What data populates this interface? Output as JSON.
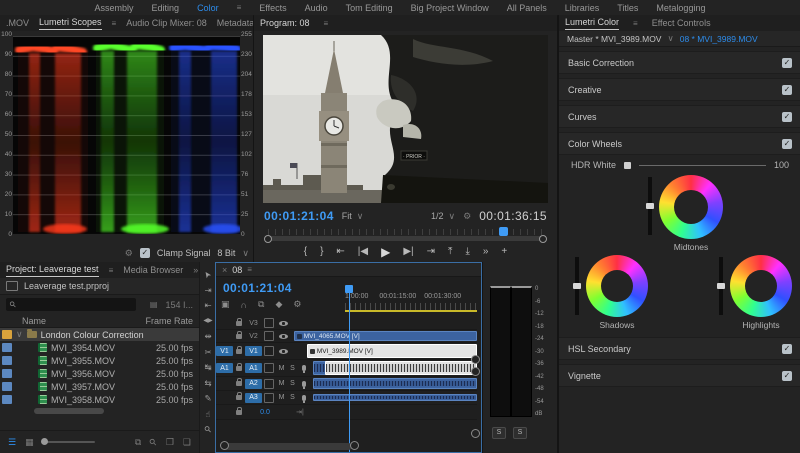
{
  "colors": {
    "accent": "#2d8ceb",
    "timecode_blue": "#3f9bf5",
    "selected_clip": "#e4e4e4",
    "clip_blue": "#3c63a0",
    "work_bar_yellow": "#c9b929",
    "track_chip_blue": "#2d6da8",
    "folder_label": "#d9a33c",
    "clip_label": "#5c88c0"
  },
  "workspace": {
    "tabs": [
      "Assembly",
      "Editing",
      "Color",
      "Effects",
      "Audio",
      "Tom Editing",
      "Big Project Window",
      "All Panels",
      "Libraries",
      "Titles",
      "Metalogging"
    ],
    "active_tab": "Color",
    "menu_glyph": "≡"
  },
  "scopes": {
    "hidden_tab": ".MOV",
    "tab_active": "Lumetri Scopes",
    "tab2": "Audio Clip Mixer: 08",
    "tab3": "Metadata",
    "overflow": "»",
    "left_axis": [
      "100",
      "90",
      "80",
      "70",
      "60",
      "50",
      "40",
      "30",
      "20",
      "10",
      "0"
    ],
    "right_axis": [
      "255",
      "230",
      "204",
      "178",
      "153",
      "127",
      "102",
      "76",
      "51",
      "25",
      "0"
    ],
    "footer": {
      "wrench": "⚙",
      "clamp_label": "Clamp Signal",
      "bit_depth": "8 Bit",
      "caret": "∨",
      "check": "✓"
    }
  },
  "chart_data": {
    "type": "rgb-parade-waveform",
    "title": "Lumetri Scopes — RGB Parade",
    "ylabel_left_percent": [
      100,
      90,
      80,
      70,
      60,
      50,
      40,
      30,
      20,
      10,
      0
    ],
    "ylabel_right_8bit": [
      255,
      230,
      204,
      178,
      153,
      127,
      102,
      76,
      51,
      25,
      0
    ],
    "channels": [
      "red",
      "green",
      "blue"
    ],
    "highlight_level_percent": 93,
    "shadow_level_percent": 2,
    "grid": true
  },
  "program": {
    "tab": "Program: 08",
    "menu_glyph": "≡",
    "timecode": "00:01:21:04",
    "zoom_level": "Fit",
    "playback_resolution": "1/2",
    "duration": "00:01:36:15",
    "caret": "∨",
    "wrench": "⚙",
    "playhead_pos_pct": 84,
    "plaque_text": "· PRIOR ·",
    "transport": {
      "mark_in": "{",
      "mark_out": "}",
      "go_to_in": "⇤",
      "step_back": "|◀",
      "play": "▶",
      "step_fwd": "▶|",
      "go_to_out": "⇥",
      "lift": "⤒",
      "extract": "⤓",
      "more": "»",
      "add": "+"
    }
  },
  "lumetri": {
    "tab_active": "Lumetri Color",
    "tab2": "Effect Controls",
    "menu_glyph": "≡",
    "master_label": "Master * MVI_3989.MOV",
    "clip_label": "08 * MVI_3989.MOV",
    "caret": "∨",
    "sections": [
      "Basic Correction",
      "Creative",
      "Curves",
      "Color Wheels",
      "HSL Secondary",
      "Vignette"
    ],
    "check": "✓",
    "hdr_white": {
      "label": "HDR White",
      "max": "100"
    },
    "wheels": [
      "Shadows",
      "Midtones",
      "Highlights"
    ]
  },
  "project": {
    "tab_active": "Project: Leaverage test",
    "tab2": "Media Browser",
    "overflow": "»",
    "file_name": "Leaverage test.prproj",
    "search_glyph": "⚲",
    "items_count": "154 I...",
    "columns": {
      "name": "Name",
      "frame_rate": "Frame Rate"
    },
    "folder": {
      "chevron": "∨",
      "name": "London Colour Correction"
    },
    "clips": [
      {
        "name": "MVI_3954.MOV",
        "fps": "25.00 fps"
      },
      {
        "name": "MVI_3955.MOV",
        "fps": "25.00 fps"
      },
      {
        "name": "MVI_3956.MOV",
        "fps": "25.00 fps"
      },
      {
        "name": "MVI_3957.MOV",
        "fps": "25.00 fps"
      },
      {
        "name": "MVI_3958.MOV",
        "fps": "25.00 fps"
      }
    ],
    "footer": {
      "list_view": "☰",
      "icon_view": "▦",
      "automate": "⧉",
      "find": "⚲",
      "new_bin": "❒",
      "new_item": "❏"
    }
  },
  "tools": {
    "items": [
      {
        "name": "selection",
        "glyph": "➤"
      },
      {
        "name": "track-select-forward",
        "glyph": "⇥"
      },
      {
        "name": "ripple-edit",
        "glyph": "⇤"
      },
      {
        "name": "rolling-edit",
        "glyph": "◀▶"
      },
      {
        "name": "rate-stretch",
        "glyph": "⇹"
      },
      {
        "name": "razor",
        "glyph": "✂"
      },
      {
        "name": "slip",
        "glyph": "↹"
      },
      {
        "name": "slide",
        "glyph": "⇆"
      },
      {
        "name": "pen",
        "glyph": "✎"
      },
      {
        "name": "hand",
        "glyph": "☝"
      },
      {
        "name": "zoom",
        "glyph": "⚲"
      }
    ]
  },
  "timeline": {
    "close": "×",
    "tab": "08",
    "menu_glyph": "≡",
    "timecode": "00:01:21:04",
    "icons": {
      "nest": "▣",
      "snap": "∩",
      "linked": "⧉",
      "marker": "◆",
      "settings": "⚙"
    },
    "ruler_ticks": [
      "1:00:00",
      "00:01:15:00",
      "00:01:30:00"
    ],
    "tracks": {
      "v3": "V3",
      "v2": "V2",
      "v1": "V1",
      "a1": "A1",
      "a2": "A2",
      "a3": "A3"
    },
    "source_v": "V1",
    "source_a": "A1",
    "mute": "M",
    "solo": "S",
    "master_level": "0.0",
    "fit_glyph": "⇥|",
    "clips": {
      "v2": "MVI_4065.MOV [V]",
      "v1": "MVI_3989.MOV [V]"
    }
  },
  "meters": {
    "scale": [
      "0",
      "-6",
      "-12",
      "-18",
      "-24",
      "-30",
      "-36",
      "-42",
      "-48",
      "-54",
      "dB"
    ],
    "solo_left": "S",
    "solo_right": "S"
  }
}
